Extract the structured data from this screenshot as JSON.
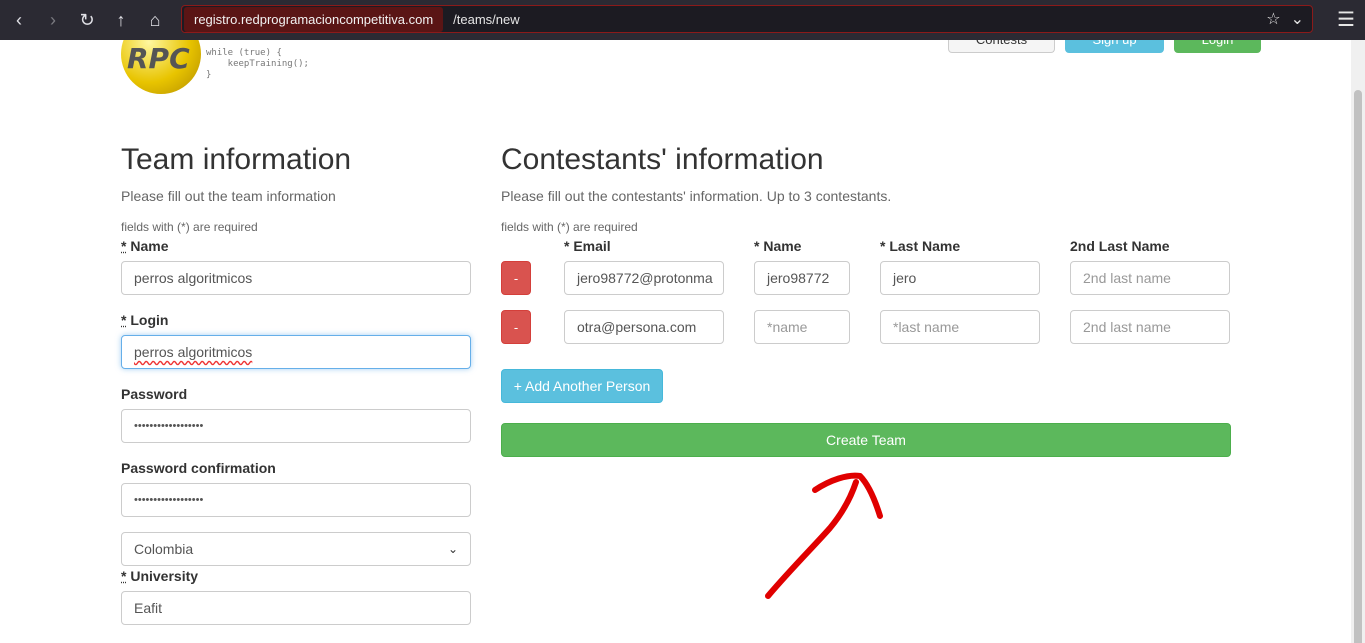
{
  "browser": {
    "url_domain": "registro.redprogramacioncompetitiva.com",
    "url_path": "/teams/new"
  },
  "header": {
    "logo_text": "RPC",
    "code_snippet": "while (true) {\n    keepTraining();\n}",
    "contests_label": "Contests",
    "signup_label": "Sign up",
    "login_label": "Login"
  },
  "team": {
    "title": "Team information",
    "subtitle": "Please fill out the team information",
    "required_note": "fields with (*) are required",
    "name_label": "Name",
    "name_value": "perros algoritmicos",
    "login_label": "Login",
    "login_value": "perros algoritmicos",
    "password_label": "Password",
    "password_value": "••••••••••••••••••",
    "password_confirmation_label": "Password confirmation",
    "password_confirmation_value": "••••••••••••••••••",
    "country_value": "Colombia",
    "university_label": "University",
    "university_value": "Eafit"
  },
  "contestants": {
    "title": "Contestants' information",
    "subtitle": "Please fill out the contestants' information. Up to 3 contestants.",
    "required_note": "fields with (*) are required",
    "col_email": "* Email",
    "col_name": "* Name",
    "col_last_name": "* Last Name",
    "col_second_last_name": "2nd Last Name",
    "remove_label": "-",
    "rows": [
      {
        "email": "jero98772@protonma",
        "name": "jero98772",
        "last_name": "jero",
        "second_last_name": "2nd last name"
      },
      {
        "email": "otra@persona.com",
        "name": "*name",
        "last_name": "*last name",
        "second_last_name": "2nd last name"
      }
    ],
    "add_person_label": "+ Add Another Person",
    "create_team_label": "Create Team"
  },
  "colors": {
    "primary_green": "#5cb85c",
    "info_blue": "#5bc0de",
    "danger_red": "#d9534f",
    "annotation_red": "#e00000"
  }
}
